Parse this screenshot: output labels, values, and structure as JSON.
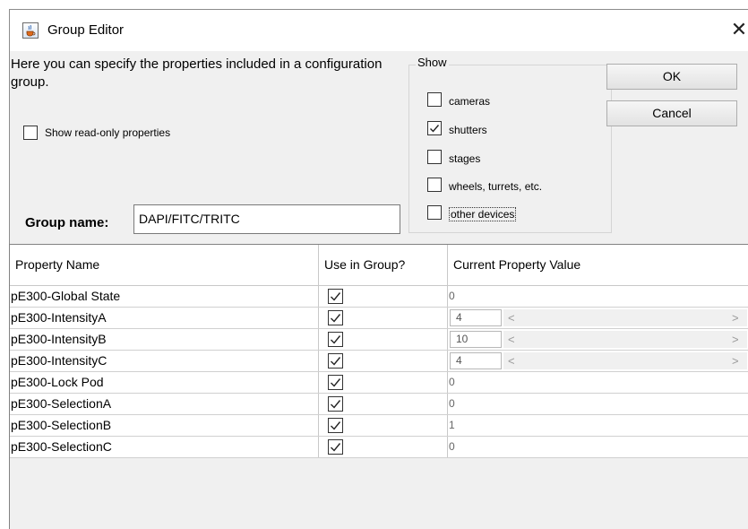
{
  "window": {
    "title": "Group Editor",
    "icon": "java-cup-icon",
    "close_icon": "close-icon"
  },
  "description": "Here you can specify the properties included in a configuration group.",
  "show_readonly": {
    "label": "Show read-only properties",
    "checked": false
  },
  "show_group": {
    "legend": "Show",
    "items": [
      {
        "label": "cameras",
        "checked": false
      },
      {
        "label": "shutters",
        "checked": true
      },
      {
        "label": "stages",
        "checked": false
      },
      {
        "label": "wheels, turrets, etc.",
        "checked": false
      },
      {
        "label": "other devices",
        "checked": false
      }
    ]
  },
  "buttons": {
    "ok": "OK",
    "cancel": "Cancel"
  },
  "group_name": {
    "label": "Group name:",
    "value": "DAPI/FITC/TRITC"
  },
  "table": {
    "headers": [
      "Property Name",
      "Use in Group?",
      "Current Property Value"
    ],
    "rows": [
      {
        "name": "pE300-Global State",
        "use": true,
        "value": "0",
        "slider": false
      },
      {
        "name": "pE300-IntensityA",
        "use": true,
        "value": "4",
        "slider": true
      },
      {
        "name": "pE300-IntensityB",
        "use": true,
        "value": "10",
        "slider": true
      },
      {
        "name": "pE300-IntensityC",
        "use": true,
        "value": "4",
        "slider": true
      },
      {
        "name": "pE300-Lock Pod",
        "use": true,
        "value": "0",
        "slider": false
      },
      {
        "name": "pE300-SelectionA",
        "use": true,
        "value": "0",
        "slider": false
      },
      {
        "name": "pE300-SelectionB",
        "use": true,
        "value": "1",
        "slider": false
      },
      {
        "name": "pE300-SelectionC",
        "use": true,
        "value": "0",
        "slider": false
      }
    ]
  },
  "slider_arrows": {
    "left": "<",
    "right": ">"
  }
}
